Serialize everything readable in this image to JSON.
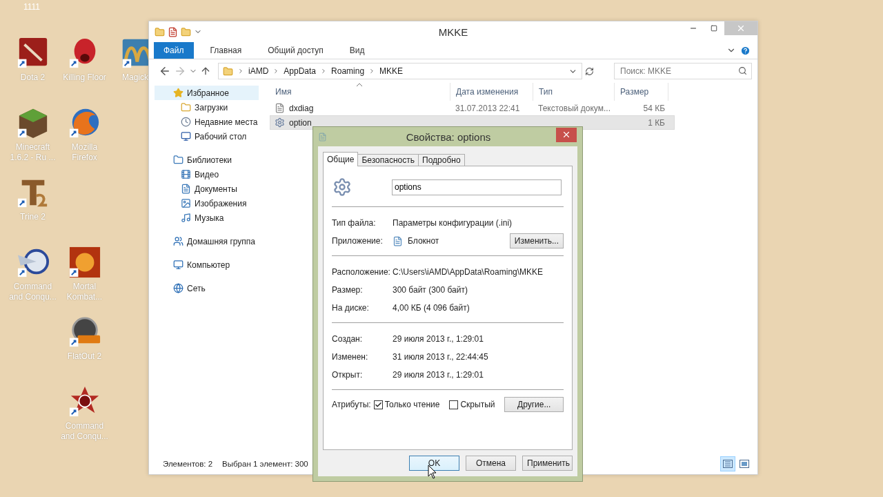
{
  "desktop": {
    "corner_text": "1111",
    "icons": [
      {
        "label": "Dota 2"
      },
      {
        "label": "Killing Floor"
      },
      {
        "label": "Magick"
      },
      {
        "label": "Minecraft 1.6.2 - Ru ..."
      },
      {
        "label": "Mozilla Firefox"
      },
      {
        "label": "Trine 2"
      },
      {
        "label": "Command and Conqu..."
      },
      {
        "label": "Mortal Kombat..."
      },
      {
        "label": "FlatOut 2"
      },
      {
        "label": "Command and Conqu..."
      }
    ]
  },
  "explorer": {
    "title": "MKKE",
    "ribbon_tabs": [
      {
        "label": "Файл",
        "selected": true
      },
      {
        "label": "Главная",
        "selected": false
      },
      {
        "label": "Общий доступ",
        "selected": false
      },
      {
        "label": "Вид",
        "selected": false
      }
    ],
    "breadcrumb": [
      "iAMD",
      "AppData",
      "Roaming",
      "MKKE"
    ],
    "search": {
      "placeholder": "Поиск: MKKE"
    },
    "nav": [
      {
        "label": "Избранное",
        "selected": true,
        "children": [
          {
            "label": "Загрузки",
            "selected": false
          },
          {
            "label": "Недавние места",
            "selected": false
          },
          {
            "label": "Рабочий стол",
            "selected": false
          }
        ]
      },
      {
        "label": "Библиотеки",
        "selected": false,
        "children": [
          {
            "label": "Видео",
            "selected": false
          },
          {
            "label": "Документы",
            "selected": false
          },
          {
            "label": "Изображения",
            "selected": false
          },
          {
            "label": "Музыка",
            "selected": false
          }
        ]
      },
      {
        "label": "Домашняя группа",
        "selected": false
      },
      {
        "label": "Компьютер",
        "selected": false
      },
      {
        "label": "Сеть",
        "selected": false
      }
    ],
    "columns": [
      "Имя",
      "Дата изменения",
      "Тип",
      "Размер"
    ],
    "rows": [
      {
        "name": "dxdiag",
        "date": "31.07.2013 22:41",
        "type": "Текстовый докум...",
        "size": "54 КБ",
        "selected": false
      },
      {
        "name": "option",
        "size": "1 КБ",
        "selected": true
      }
    ],
    "status": {
      "count": "Элементов: 2",
      "selection": "Выбран 1 элемент: 300"
    },
    "views": [
      {
        "selected": true
      },
      {
        "selected": false
      }
    ]
  },
  "dialog": {
    "title": "Свойства: options",
    "tabs": [
      {
        "label": "Общие",
        "selected": true
      },
      {
        "label": "Безопасность",
        "selected": false
      },
      {
        "label": "Подробно",
        "selected": false
      }
    ],
    "file_name": "options",
    "sections": [
      {
        "rows": [
          {
            "kind": "text",
            "label": "Тип файла:",
            "value": "Параметры конфигурации (.ini)"
          },
          {
            "kind": "app",
            "label": "Приложение:",
            "value": "Блокнот",
            "button": "Изменить..."
          }
        ]
      },
      {
        "rows": [
          {
            "kind": "text",
            "label": "Расположение:",
            "value": "C:\\Users\\iAMD\\AppData\\Roaming\\MKKE"
          },
          {
            "kind": "text",
            "label": "Размер:",
            "value": "300 байт (300 байт)"
          },
          {
            "kind": "text",
            "label": "На диске:",
            "value": "4,00 КБ (4 096 байт)"
          }
        ]
      },
      {
        "rows": [
          {
            "kind": "text",
            "label": "Создан:",
            "value": "29 июля 2013 г., 1:29:01"
          },
          {
            "kind": "text",
            "label": "Изменен:",
            "value": "31 июля 2013 г., 22:44:45"
          },
          {
            "kind": "text",
            "label": "Открыт:",
            "value": "29 июля 2013 г., 1:29:01"
          }
        ]
      }
    ],
    "attributes": {
      "label": "Атрибуты:",
      "options": [
        {
          "label": "Только чтение",
          "checked": true
        },
        {
          "label": "Скрытый",
          "checked": false
        }
      ],
      "button": "Другие..."
    },
    "buttons": [
      {
        "label": "OK",
        "focused": true
      },
      {
        "label": "Отмена",
        "focused": false
      },
      {
        "label": "Применить",
        "focused": false
      }
    ]
  }
}
